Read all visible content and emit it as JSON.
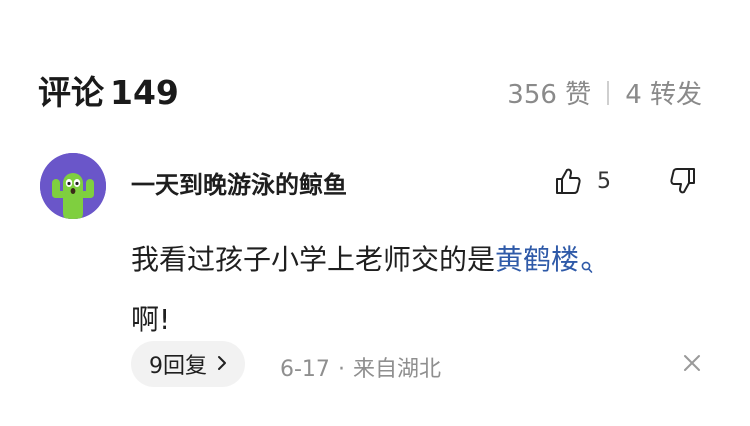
{
  "header": {
    "title": "评论",
    "count": "149",
    "likes": "356 赞",
    "reposts": "4 转发"
  },
  "comment": {
    "author": "一天到晚游泳的鲸鱼",
    "like_count": "5",
    "text_before": "我看过孩子小学上老师交的是",
    "keyword": "黄鹤楼",
    "text_after": "啊!",
    "reply_label": "9回复",
    "date": "6-17",
    "separator": "·",
    "location": "来自湖北"
  },
  "colors": {
    "avatar_bg": "#6a56c9",
    "cactus": "#7fcf3f",
    "keyword": "#2f5aa8"
  },
  "icons": {
    "like": "thumbs-up-icon",
    "dislike": "thumbs-down-icon",
    "keyword_search": "search-icon",
    "reply_chevron": "chevron-right-icon",
    "close": "close-icon"
  }
}
